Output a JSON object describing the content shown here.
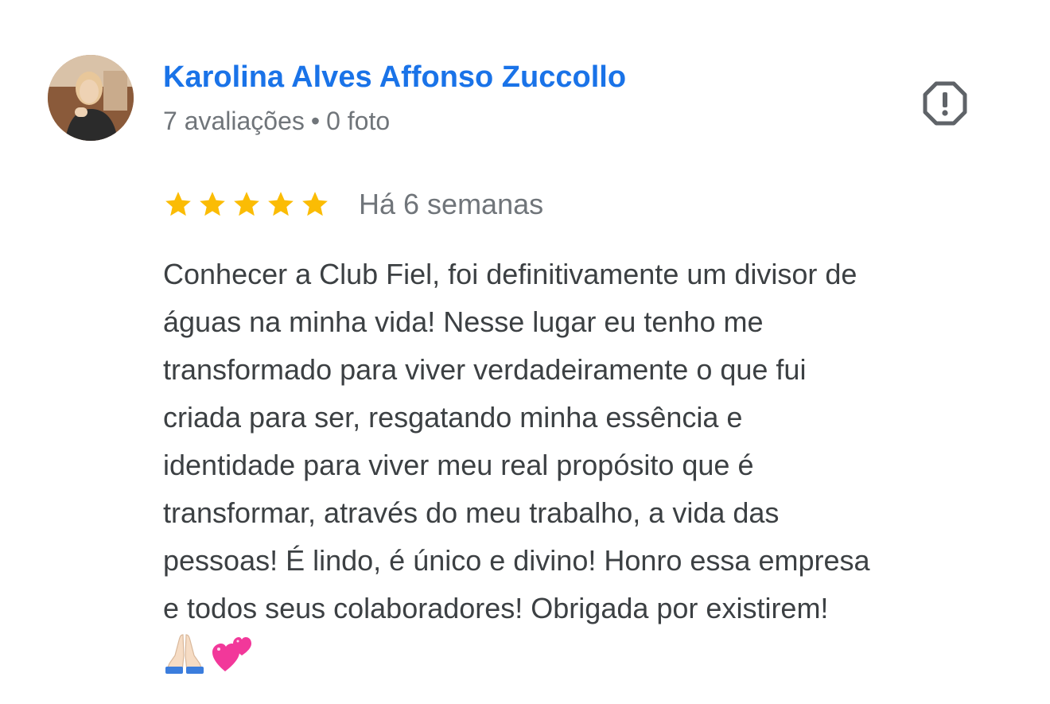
{
  "review": {
    "author": {
      "name": "Karolina Alves Affonso Zuccollo",
      "reviews_count": "7 avaliações",
      "separator": "•",
      "photos_count": "0 foto"
    },
    "rating": {
      "value": 5,
      "max": 5
    },
    "star_color": "#fbbc04",
    "time_ago": "Há 6 semanas",
    "text_lines": [
      "Conhecer a Club Fiel, foi definitivamente um divisor de",
      "águas na minha vida! Nesse lugar eu tenho me",
      "transformado para viver verdadeiramente o que fui",
      "criada para ser, resgatando minha essência e",
      "identidade para viver meu real propósito que é",
      "transformar, através do meu trabalho, a vida das",
      "pessoas! É lindo, é único e divino! Honro essa empresa",
      "e todos seus colaboradores! Obrigada por existirem!"
    ],
    "emojis": [
      "praying-hands-icon",
      "two-hearts-icon"
    ]
  },
  "colors": {
    "name_link": "#1a73e8",
    "secondary_text": "#70757a",
    "body_text": "#3c4043",
    "report_icon": "#5f6368"
  },
  "icons": {
    "report": "report-flag-octagon-icon"
  }
}
